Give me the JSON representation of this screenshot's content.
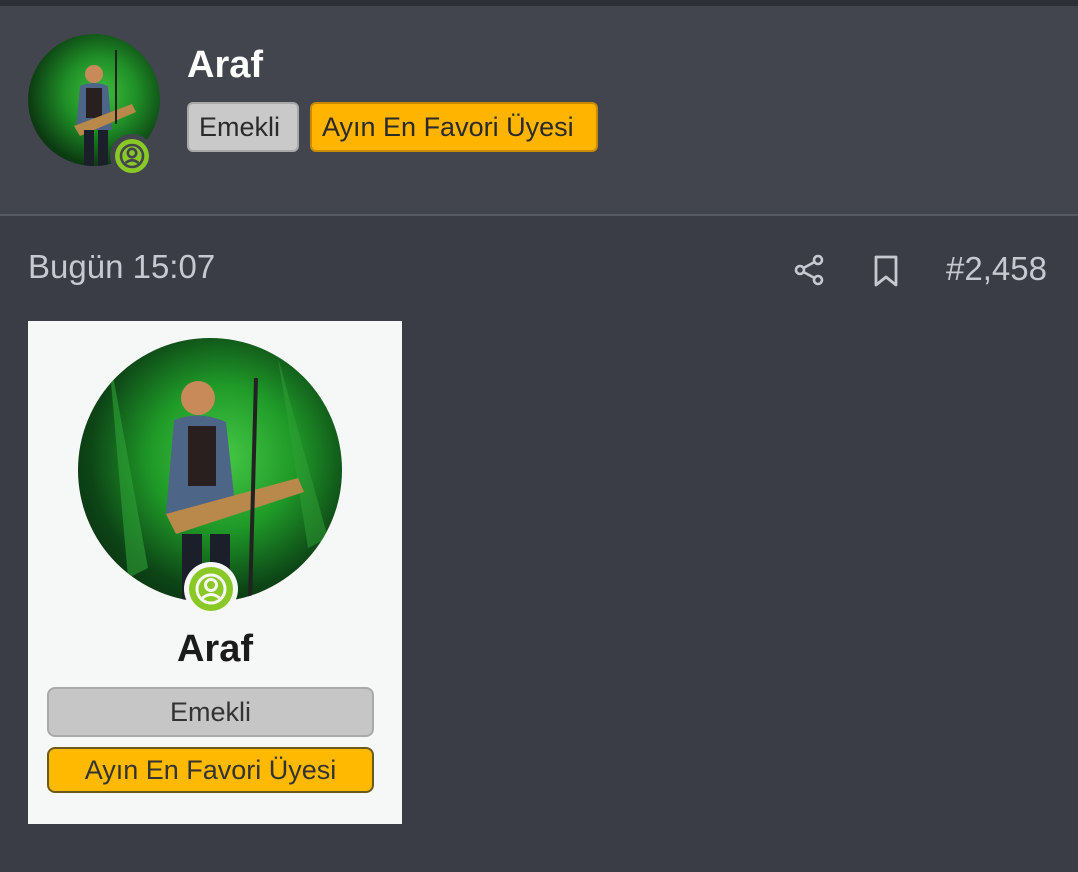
{
  "user": {
    "name": "Araf",
    "badges": [
      "Emekli",
      "Ayın En Favori Üyesi"
    ]
  },
  "post": {
    "timestamp": "Bugün 15:07",
    "number": "#2,458"
  },
  "icons": {
    "share": "share-icon",
    "bookmark": "bookmark-icon",
    "status": "user-status-icon"
  },
  "card": {
    "name": "Araf",
    "badges": [
      "Emekli",
      "Ayın En Favori Üyesi"
    ]
  },
  "colors": {
    "background": "#3a3d45",
    "header": "#42454d",
    "status_green": "#8ac826",
    "badge_gold": "#ffb400",
    "badge_gray": "#c9c9c9"
  }
}
